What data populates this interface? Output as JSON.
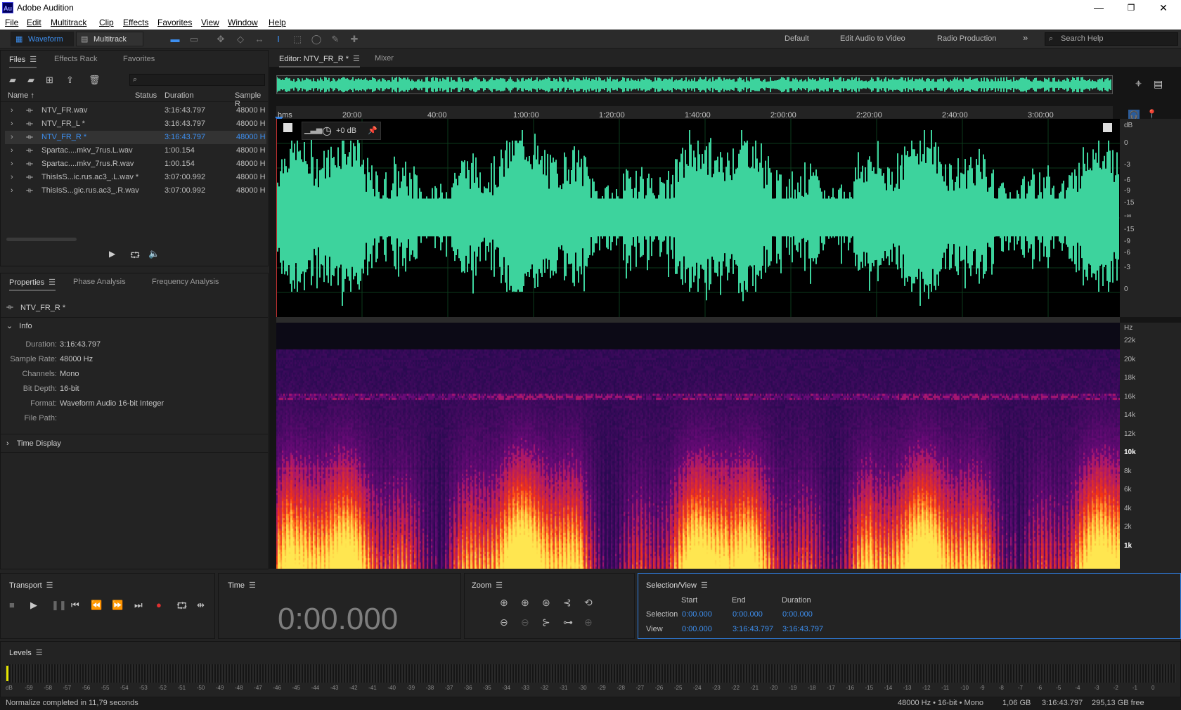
{
  "window": {
    "title": "Adobe Audition",
    "logo_text": "Au",
    "minimize": "—",
    "maximize": "❐",
    "close": "✕"
  },
  "menu": [
    "File",
    "Edit",
    "Multitrack",
    "Clip",
    "Effects",
    "Favorites",
    "View",
    "Window",
    "Help"
  ],
  "toolbar": {
    "waveform_label": "Waveform",
    "multitrack_label": "Multitrack",
    "workspaces": [
      "Default",
      "Edit Audio to Video",
      "Radio Production"
    ],
    "more": "»",
    "search_placeholder": "Search Help"
  },
  "files_panel": {
    "tabs": [
      "Files",
      "Effects Rack",
      "Favorites"
    ],
    "columns": [
      "Name",
      "Status",
      "Duration",
      "Sample R"
    ],
    "files": [
      {
        "name": "NTV_FR.wav",
        "duration": "3:16:43.797",
        "rate": "48000 H"
      },
      {
        "name": "NTV_FR_L *",
        "duration": "3:16:43.797",
        "rate": "48000 H"
      },
      {
        "name": "NTV_FR_R *",
        "duration": "3:16:43.797",
        "rate": "48000 H",
        "selected": true
      },
      {
        "name": "Spartac....mkv_7rus.L.wav",
        "duration": "1:00.154",
        "rate": "48000 H"
      },
      {
        "name": "Spartac....mkv_7rus.R.wav",
        "duration": "1:00.154",
        "rate": "48000 H"
      },
      {
        "name": "ThisIsS...ic.rus.ac3_.L.wav *",
        "duration": "3:07:00.992",
        "rate": "48000 H"
      },
      {
        "name": "ThisIsS...gic.rus.ac3_.R.wav",
        "duration": "3:07:00.992",
        "rate": "48000 H"
      }
    ]
  },
  "properties_panel": {
    "tabs": [
      "Properties",
      "Phase Analysis",
      "Frequency Analysis"
    ],
    "file_name": "NTV_FR_R *",
    "info_heading": "Info",
    "info": [
      {
        "label": "Duration:",
        "value": "3:16:43.797"
      },
      {
        "label": "Sample Rate:",
        "value": "48000 Hz"
      },
      {
        "label": "Channels:",
        "value": "Mono"
      },
      {
        "label": "Bit Depth:",
        "value": "16-bit"
      },
      {
        "label": "Format:",
        "value": "Waveform Audio 16-bit Integer"
      },
      {
        "label": "File Path:",
        "value": ""
      }
    ],
    "time_display_heading": "Time Display"
  },
  "editor": {
    "tabs": [
      "Editor: NTV_FR_R *",
      "Mixer"
    ],
    "timeline": [
      "hms",
      "20:00",
      "40:00",
      "1:00:00",
      "1:20:00",
      "1:40:00",
      "2:00:00",
      "2:20:00",
      "2:40:00",
      "3:00:00"
    ],
    "gain": "+0 dB",
    "db_unit": "dB",
    "db_scale": [
      "0",
      "-3",
      "-6",
      "-9",
      "-15",
      "-∞",
      "-15",
      "-9",
      "-6",
      "-3",
      "0"
    ],
    "hz_unit": "Hz",
    "hz_scale": [
      "22k",
      "20k",
      "18k",
      "16k",
      "14k",
      "12k",
      "10k",
      "8k",
      "6k",
      "4k",
      "2k",
      "1k"
    ]
  },
  "transport": {
    "title": "Transport"
  },
  "time": {
    "title": "Time",
    "value": "0:00.000"
  },
  "zoom": {
    "title": "Zoom"
  },
  "selection_view": {
    "title": "Selection/View",
    "headers": [
      "Start",
      "End",
      "Duration"
    ],
    "rows": [
      {
        "label": "Selection",
        "start": "0:00.000",
        "end": "0:00.000",
        "duration": "0:00.000"
      },
      {
        "label": "View",
        "start": "0:00.000",
        "end": "3:16:43.797",
        "duration": "3:16:43.797"
      }
    ]
  },
  "levels": {
    "title": "Levels",
    "scale": [
      "dB",
      "-59",
      "-58",
      "-57",
      "-56",
      "-55",
      "-54",
      "-53",
      "-52",
      "-51",
      "-50",
      "-49",
      "-48",
      "-47",
      "-46",
      "-45",
      "-44",
      "-43",
      "-42",
      "-41",
      "-40",
      "-39",
      "-38",
      "-37",
      "-36",
      "-35",
      "-34",
      "-33",
      "-32",
      "-31",
      "-30",
      "-29",
      "-28",
      "-27",
      "-26",
      "-25",
      "-24",
      "-23",
      "-22",
      "-21",
      "-20",
      "-19",
      "-18",
      "-17",
      "-16",
      "-15",
      "-14",
      "-13",
      "-12",
      "-11",
      "-10",
      "-9",
      "-8",
      "-7",
      "-6",
      "-5",
      "-4",
      "-3",
      "-2",
      "-1",
      "0"
    ]
  },
  "status": {
    "message": "Normalize completed in 11,79 seconds",
    "format": "48000 Hz • 16-bit • Mono",
    "size": "1,06 GB",
    "duration": "3:16:43.797",
    "free": "295,13 GB free"
  },
  "colors": {
    "waveform": "#3dd39d",
    "accent": "#3d8ff0",
    "playhead": "#2f7fe3"
  }
}
